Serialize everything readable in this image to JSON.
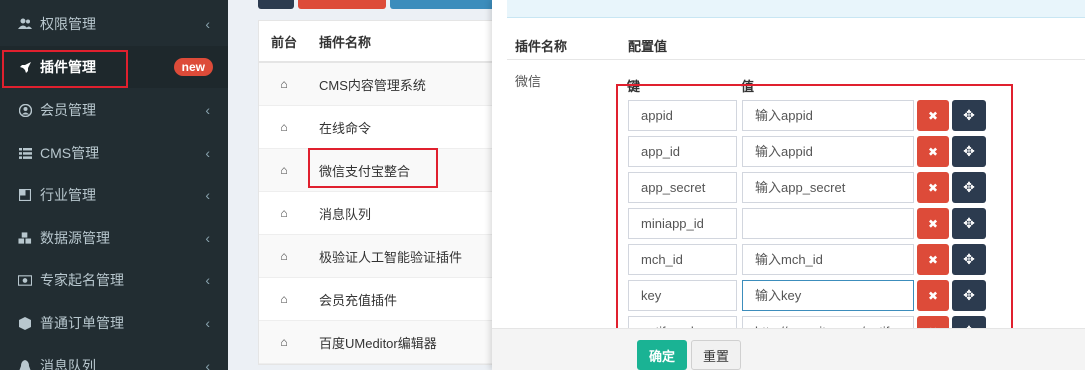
{
  "sidebar": {
    "items": [
      {
        "label": "权限管理",
        "icon": "users-icon"
      },
      {
        "label": "插件管理",
        "icon": "rocket-icon",
        "badge": "new"
      },
      {
        "label": "会员管理",
        "icon": "user-circle-icon"
      },
      {
        "label": "CMS管理",
        "icon": "list-icon"
      },
      {
        "label": "行业管理",
        "icon": "square-icon"
      },
      {
        "label": "数据源管理",
        "icon": "cubes-icon"
      },
      {
        "label": "专家起名管理",
        "icon": "money-icon"
      },
      {
        "label": "普通订单管理",
        "icon": "cube-icon"
      },
      {
        "label": "消息队列",
        "icon": "bell-icon"
      }
    ]
  },
  "table": {
    "headers": [
      "前台",
      "插件名称"
    ],
    "rows": [
      "CMS内容管理系统",
      "在线命令",
      "微信支付宝整合",
      "消息队列",
      "极验证人工智能验证插件",
      "会员充值插件",
      "百度UMeditor编辑器"
    ]
  },
  "panel": {
    "header_name": "插件名称",
    "header_value": "配置值",
    "plugin_name": "微信",
    "kv_key_header": "键",
    "kv_value_header": "值",
    "rows": [
      {
        "key": "appid",
        "value": "输入appid"
      },
      {
        "key": "app_id",
        "value": "输入appid"
      },
      {
        "key": "app_secret",
        "value": "输入app_secret"
      },
      {
        "key": "miniapp_id",
        "value": ""
      },
      {
        "key": "mch_id",
        "value": "输入mch_id"
      },
      {
        "key": "key",
        "value": "输入key"
      },
      {
        "key": "notify_url",
        "value": "http://yoursite.com/notify"
      }
    ],
    "ok_label": "确定",
    "reset_label": "重置"
  },
  "colors": {
    "sidebar_bg": "#222d32",
    "highlight": "#e0202e",
    "delete": "#dd4b39",
    "move": "#2c3b4f",
    "ok": "#1ab394"
  }
}
